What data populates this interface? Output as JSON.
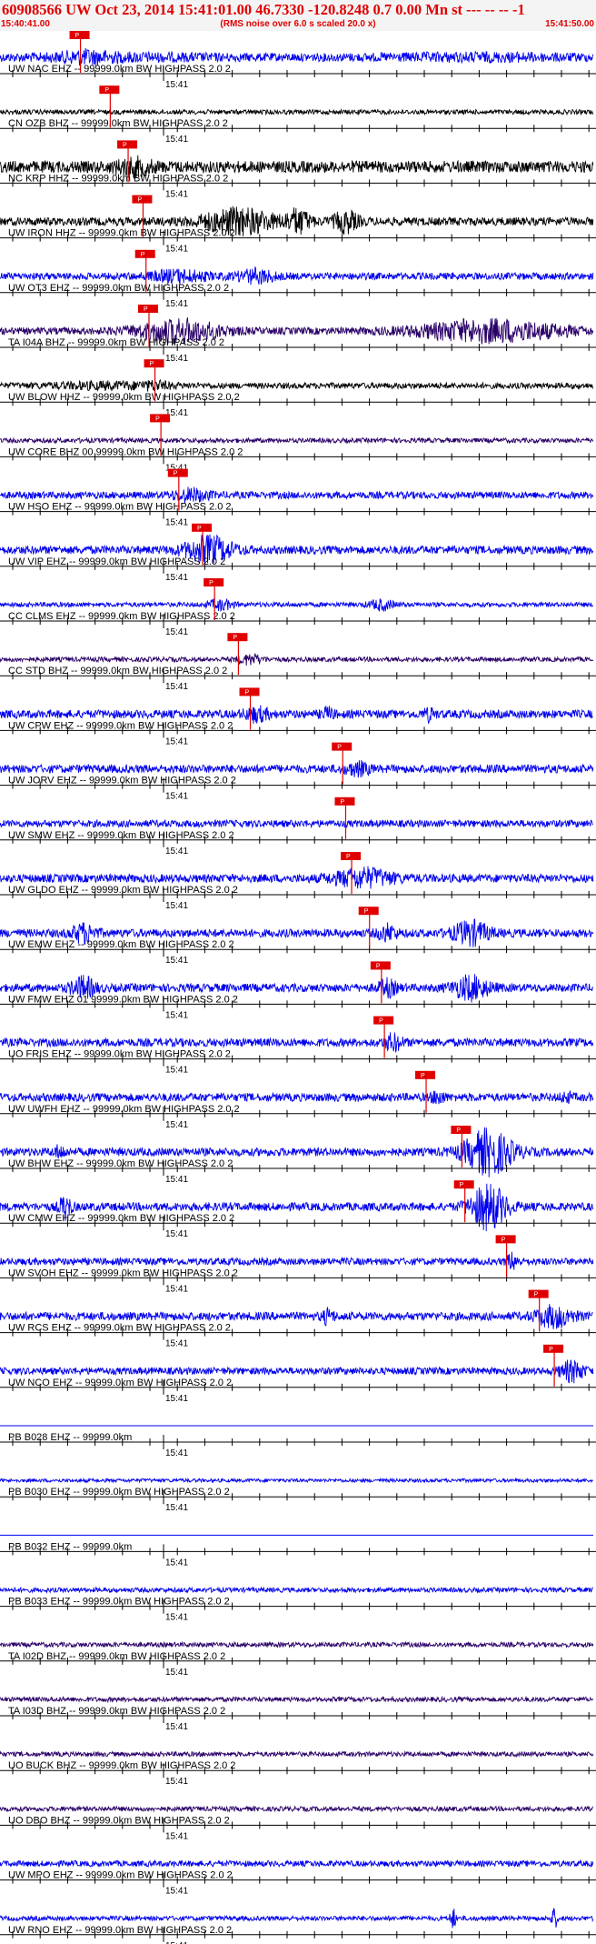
{
  "header": {
    "title": "60908566 UW Oct 23, 2014 15:41:01.00   46.7330 -120.8248  0.7 0.00 Mn st --- -- --  -1",
    "start_time": "15:40:41.00",
    "subtitle": "(RMS noise over 6.0 s scaled 20.0 x)",
    "end_time": "15:41:50.00"
  },
  "colors": {
    "trace_primary": "#0000ee",
    "trace_secondary": "#000000",
    "trace_tertiary": "#2a0068",
    "pick": "#e00000",
    "text": "#000000",
    "header_text": "#e00000"
  },
  "chart_data": {
    "type": "line",
    "title": "60908566 UW Oct 23, 2014 15:41:01.00   46.7330 -120.8248  0.7 0.00 Mn st --- -- --  -1",
    "x_range": [
      "15:40:41.00",
      "15:41:50.00"
    ],
    "minute_marker": "15:41",
    "pick_label": "P",
    "traces": [
      {
        "label": "UW NAC EHZ -- 99999.0km BW  HIGHPASS  2.0  2",
        "color": "primary",
        "pick": 0.135,
        "amp": 0.35,
        "events": [
          [
            0.145,
            0.3,
            0.04
          ],
          [
            0.2,
            0.15,
            0.15
          ],
          [
            0.8,
            0.15,
            0.15
          ]
        ]
      },
      {
        "label": "CN OZB BHZ -- 99999.0km BW  HIGHPASS  2.0  2",
        "color": "secondary",
        "pick": 0.185,
        "amp": 0.2,
        "events": []
      },
      {
        "label": "NC KRP HHZ -- 99999.0km BW  HIGHPASS  2.0  2",
        "color": "secondary",
        "pick": 0.215,
        "amp": 0.5,
        "events": [
          [
            0.225,
            0.5,
            0.03
          ]
        ]
      },
      {
        "label": "UW IRON HHZ -- 99999.0km BW  HIGHPASS  2.0  2",
        "color": "secondary",
        "pick": 0.24,
        "amp": 0.35,
        "events": [
          [
            0.4,
            1.0,
            0.06
          ],
          [
            0.5,
            0.9,
            0.02
          ],
          [
            0.58,
            0.8,
            0.02
          ]
        ]
      },
      {
        "label": "UW OT3 EHZ -- 99999.0km BW  HIGHPASS  2.0  2",
        "color": "primary",
        "pick": 0.245,
        "amp": 0.3,
        "events": [
          [
            0.3,
            0.4,
            0.05
          ],
          [
            0.43,
            0.5,
            0.03
          ]
        ]
      },
      {
        "label": "TA I04A BHZ -- 99999.0km BW  HIGHPASS  2.0  2",
        "color": "tertiary",
        "pick": 0.25,
        "amp": 0.3,
        "events": [
          [
            0.3,
            0.9,
            0.07
          ],
          [
            0.82,
            0.85,
            0.12
          ]
        ]
      },
      {
        "label": "UW BLOW HHZ -- 99999.0km BW  HIGHPASS  2.0  2",
        "color": "secondary",
        "pick": 0.26,
        "amp": 0.25,
        "events": [
          [
            0.18,
            0.2,
            0.1
          ],
          [
            0.26,
            0.2,
            0.02
          ]
        ]
      },
      {
        "label": "UW CORE BHZ 00 99999.0km BW  HIGHPASS  2.0  2",
        "color": "tertiary",
        "pick": 0.27,
        "amp": 0.2,
        "events": []
      },
      {
        "label": "UW HSO EHZ -- 99999.0km BW  HIGHPASS  2.0  2",
        "color": "primary",
        "pick": 0.3,
        "amp": 0.3,
        "events": [
          [
            0.32,
            0.45,
            0.03
          ]
        ]
      },
      {
        "label": "UW VIP EHZ -- 99999.0km BW  HIGHPASS  2.0  2",
        "color": "primary",
        "pick": 0.34,
        "amp": 0.35,
        "events": [
          [
            0.35,
            1.0,
            0.04
          ]
        ]
      },
      {
        "label": "CC CLMS EHZ -- 99999.0km BW  HIGHPASS  2.0  2",
        "color": "primary",
        "pick": 0.36,
        "amp": 0.2,
        "events": [
          [
            0.37,
            0.4,
            0.02
          ],
          [
            0.64,
            0.4,
            0.02
          ]
        ]
      },
      {
        "label": "CC STD BHZ -- 99999.0km BW  HIGHPASS  2.0  2",
        "color": "tertiary",
        "pick": 0.4,
        "amp": 0.2,
        "events": [
          [
            0.42,
            0.4,
            0.02
          ]
        ]
      },
      {
        "label": "UW CPW EHZ -- 99999.0km BW  HIGHPASS  2.0  2",
        "color": "primary",
        "pick": 0.42,
        "amp": 0.35,
        "events": [
          [
            0.43,
            0.5,
            0.02
          ],
          [
            0.55,
            0.4,
            0.01
          ],
          [
            0.72,
            0.4,
            0.01
          ]
        ]
      },
      {
        "label": "UW JORV EHZ -- 99999.0km BW  HIGHPASS  2.0  2",
        "color": "primary",
        "pick": 0.575,
        "amp": 0.35,
        "events": [
          [
            0.6,
            0.45,
            0.02
          ]
        ]
      },
      {
        "label": "UW SMW EHZ -- 99999.0km BW  HIGHPASS  2.0  2",
        "color": "primary",
        "pick": 0.58,
        "amp": 0.3,
        "events": []
      },
      {
        "label": "UW GLDO EHZ -- 99999.0km BW  HIGHPASS  2.0  2",
        "color": "primary",
        "pick": 0.59,
        "amp": 0.35,
        "events": [
          [
            0.61,
            0.7,
            0.05
          ]
        ]
      },
      {
        "label": "UW EMW EHZ -- 99999.0km BW  HIGHPASS  2.0  2",
        "color": "primary",
        "pick": 0.62,
        "amp": 0.35,
        "events": [
          [
            0.14,
            0.7,
            0.02
          ],
          [
            0.65,
            0.6,
            0.015
          ],
          [
            0.79,
            0.9,
            0.03
          ]
        ]
      },
      {
        "label": "UW FMW EHZ 01 99999.0km BW  HIGHPASS  2.0  2",
        "color": "primary",
        "pick": 0.64,
        "amp": 0.35,
        "events": [
          [
            0.14,
            0.8,
            0.02
          ],
          [
            0.65,
            0.6,
            0.015
          ],
          [
            0.79,
            0.9,
            0.03
          ]
        ]
      },
      {
        "label": "UO FRIS EHZ -- 99999.0km BW  HIGHPASS  2.0  2",
        "color": "primary",
        "pick": 0.645,
        "amp": 0.35,
        "events": [
          [
            0.66,
            0.6,
            0.015
          ]
        ]
      },
      {
        "label": "UW UWFH EHZ -- 99999.0km BW  HIGHPASS  2.0  2",
        "color": "primary",
        "pick": 0.715,
        "amp": 0.35,
        "events": [
          [
            0.735,
            0.5,
            0.01
          ],
          [
            0.95,
            0.3,
            0.01
          ]
        ]
      },
      {
        "label": "UW BHW EHZ -- 99999.0km BW  HIGHPASS  2.0  2",
        "color": "primary",
        "pick": 0.775,
        "amp": 0.35,
        "events": [
          [
            0.1,
            0.4,
            0.01
          ],
          [
            0.82,
            1.8,
            0.04
          ]
        ]
      },
      {
        "label": "UW CMW EHZ -- 99999.0km BW  HIGHPASS  2.0  2",
        "color": "primary",
        "pick": 0.78,
        "amp": 0.35,
        "events": [
          [
            0.11,
            0.9,
            0.01
          ],
          [
            0.82,
            1.8,
            0.03
          ]
        ]
      },
      {
        "label": "UW SVOH EHZ -- 99999.0km BW  HIGHPASS  2.0  2",
        "color": "primary",
        "pick": 0.85,
        "amp": 0.3,
        "events": [
          [
            0.86,
            0.6,
            0.01
          ]
        ]
      },
      {
        "label": "UW RCS EHZ -- 99999.0km BW  HIGHPASS  2.0  2",
        "color": "primary",
        "pick": 0.905,
        "amp": 0.35,
        "events": [
          [
            0.93,
            0.8,
            0.03
          ],
          [
            0.55,
            0.5,
            0.01
          ]
        ]
      },
      {
        "label": "UW NCO EHZ -- 99999.0km BW  HIGHPASS  2.0  2",
        "color": "primary",
        "pick": 0.93,
        "amp": 0.3,
        "events": [
          [
            0.96,
            0.8,
            0.02
          ]
        ]
      },
      {
        "label": "PB B028 EHZ -- 99999.0km",
        "color": "primary",
        "pick": null,
        "amp": 0.0,
        "events": []
      },
      {
        "label": "PB B030 EHZ -- 99999.0km BW  HIGHPASS  2.0  2",
        "color": "primary",
        "pick": null,
        "amp": 0.15,
        "events": []
      },
      {
        "label": "PB B032 EHZ -- 99999.0km",
        "color": "primary",
        "pick": null,
        "amp": 0.0,
        "events": []
      },
      {
        "label": "PB B033 EHZ -- 99999.0km BW  HIGHPASS  2.0  2",
        "color": "primary",
        "pick": null,
        "amp": 0.2,
        "events": []
      },
      {
        "label": "TA I02D BHZ -- 99999.0km BW  HIGHPASS  2.0  2",
        "color": "tertiary",
        "pick": null,
        "amp": 0.2,
        "events": []
      },
      {
        "label": "TA I03D BHZ -- 99999.0km BW  HIGHPASS  2.0  2",
        "color": "tertiary",
        "pick": null,
        "amp": 0.2,
        "events": []
      },
      {
        "label": "UO BUCK BHZ -- 99999.0km BW  HIGHPASS  2.0  2",
        "color": "tertiary",
        "pick": null,
        "amp": 0.2,
        "events": []
      },
      {
        "label": "UO DBO BHZ -- 99999.0km BW  HIGHPASS  2.0  2",
        "color": "tertiary",
        "pick": null,
        "amp": 0.2,
        "events": []
      },
      {
        "label": "UW MPO EHZ -- 99999.0km BW  HIGHPASS  2.0  2",
        "color": "primary",
        "pick": null,
        "amp": 0.25,
        "events": []
      },
      {
        "label": "UW RNO EHZ -- 99999.0km BW  HIGHPASS  2.0  2",
        "color": "primary",
        "pick": null,
        "amp": 0.2,
        "events": [
          [
            0.76,
            0.8,
            0.005
          ],
          [
            0.93,
            0.8,
            0.005
          ]
        ]
      }
    ]
  }
}
